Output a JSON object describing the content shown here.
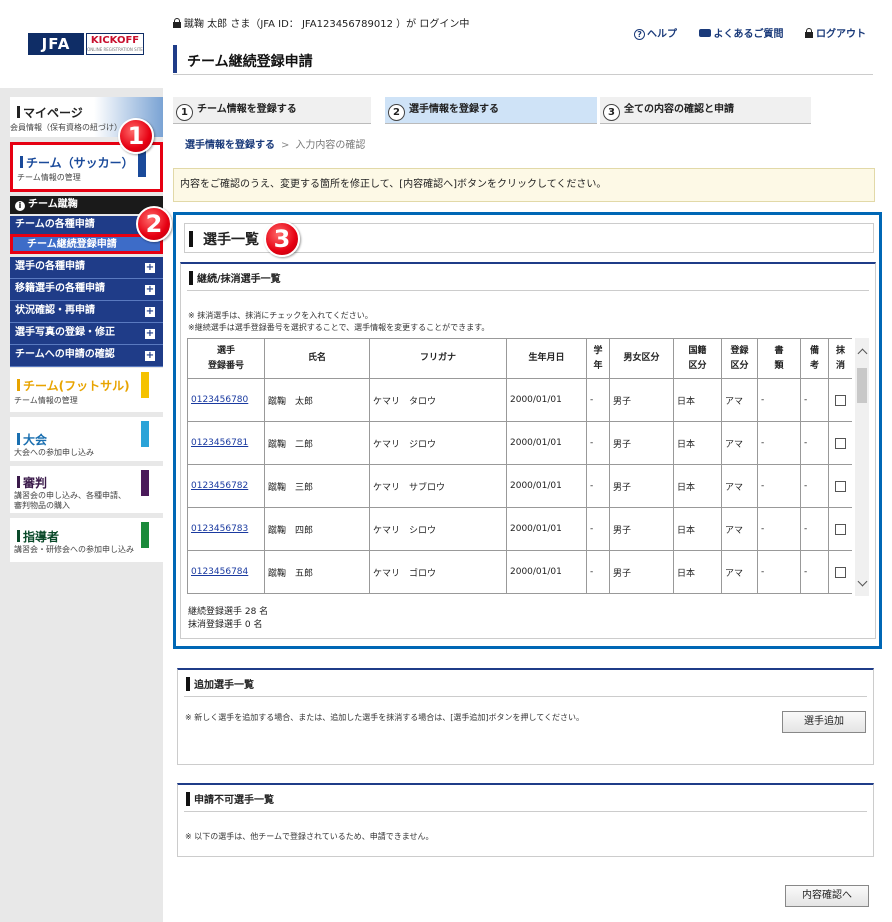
{
  "logo": {
    "jfa": "JFA",
    "kickoff": "KICKOFF",
    "kickoff_sub": "ONLINE REGISTRATION SITE"
  },
  "header": {
    "login_status": "蹴鞠 太郎 さま（JFA ID： JFA123456789012 ）が ログイン中",
    "help": "ヘルプ",
    "faq": "よくあるご質問",
    "logout": "ログアウト"
  },
  "page_title": "チーム継続登録申請",
  "steps": [
    {
      "num": "1",
      "label": "チーム情報を登録する"
    },
    {
      "num": "2",
      "label": "選手情報を登録する"
    },
    {
      "num": "3",
      "label": "全ての内容の確認と申請"
    }
  ],
  "breadcrumb": {
    "current": "選手情報を登録する",
    "separator": ">",
    "next": "入力内容の確認"
  },
  "notice": "内容をご確認のうえ、変更する箇所を修正して、[内容確認へ]ボタンをクリックしてください。",
  "sidebar": {
    "mypage": {
      "title": "マイページ",
      "sub": "会員情報（保有資格の紐づけ）"
    },
    "team_soccer": {
      "title": "チーム（サッカー）",
      "sub": "チーム情報の管理"
    },
    "team_name": "チーム蹴鞠",
    "nav_apply": "チームの各種申請",
    "nav_continue": "チーム継続登録申請",
    "nav_items": [
      "選手の各種申請",
      "移籍選手の各種申請",
      "状況確認・再申請",
      "選手写真の登録・修正",
      "チームへの申請の確認"
    ],
    "futsal": {
      "title": "チーム(フットサル)",
      "sub": "チーム情報の管理"
    },
    "taikai": {
      "title": "大会",
      "sub": "大会への参加申し込み"
    },
    "shinpan": {
      "title": "審判",
      "sub1": "講習会の申し込み、各種申請、",
      "sub2": "審判物品の購入"
    },
    "shidosha": {
      "title": "指導者",
      "sub": "講習会・研修会への参加申し込み"
    }
  },
  "badges": [
    "1",
    "2",
    "3"
  ],
  "player_list": {
    "title": "選手一覧",
    "continue_section": {
      "title": "継続/抹消選手一覧",
      "note1": "※ 抹消選手は、抹消にチェックを入れてください。",
      "note2": "※継続選手は選手登録番号を選択することで、選手情報を変更することができます。",
      "columns": [
        "選手\n登録番号",
        "氏名",
        "フリガナ",
        "生年月日",
        "学\n年",
        "男女区分",
        "国籍\n区分",
        "登録\n区分",
        "書\n類",
        "備\n考",
        "抹\n消"
      ],
      "rows": [
        {
          "id": "0123456780",
          "name": "蹴鞠　太郎",
          "kana": "ケマリ　タロウ",
          "dob": "2000/01/01",
          "grade": "-",
          "gender": "男子",
          "nationality": "日本",
          "reg": "アマ",
          "docs": "-",
          "remarks": "-"
        },
        {
          "id": "0123456781",
          "name": "蹴鞠　二郎",
          "kana": "ケマリ　ジロウ",
          "dob": "2000/01/01",
          "grade": "-",
          "gender": "男子",
          "nationality": "日本",
          "reg": "アマ",
          "docs": "-",
          "remarks": "-"
        },
        {
          "id": "0123456782",
          "name": "蹴鞠　三郎",
          "kana": "ケマリ　サブロウ",
          "dob": "2000/01/01",
          "grade": "-",
          "gender": "男子",
          "nationality": "日本",
          "reg": "アマ",
          "docs": "-",
          "remarks": "-"
        },
        {
          "id": "0123456783",
          "name": "蹴鞠　四郎",
          "kana": "ケマリ　シロウ",
          "dob": "2000/01/01",
          "grade": "-",
          "gender": "男子",
          "nationality": "日本",
          "reg": "アマ",
          "docs": "-",
          "remarks": "-"
        },
        {
          "id": "0123456784",
          "name": "蹴鞠　五郎",
          "kana": "ケマリ　ゴロウ",
          "dob": "2000/01/01",
          "grade": "-",
          "gender": "男子",
          "nationality": "日本",
          "reg": "アマ",
          "docs": "-",
          "remarks": "-"
        }
      ],
      "count_continue": "継続登録選手 28 名",
      "count_delete": "抹消登録選手 0 名"
    }
  },
  "add_section": {
    "title": "追加選手一覧",
    "note": "※ 新しく選手を追加する場合、または、追加した選手を抹消する場合は、[選手追加]ボタンを押してください。",
    "button": "選手追加"
  },
  "ng_section": {
    "title": "申請不可選手一覧",
    "note": "※ 以下の選手は、他チームで登録されているため、申請できません。"
  },
  "confirm_button": "内容確認へ",
  "colors": {
    "navy": "#1f3c88",
    "highlight_red": "#e60012",
    "panel_blue": "#0067b5",
    "notice_bg": "#fdf9e6"
  }
}
